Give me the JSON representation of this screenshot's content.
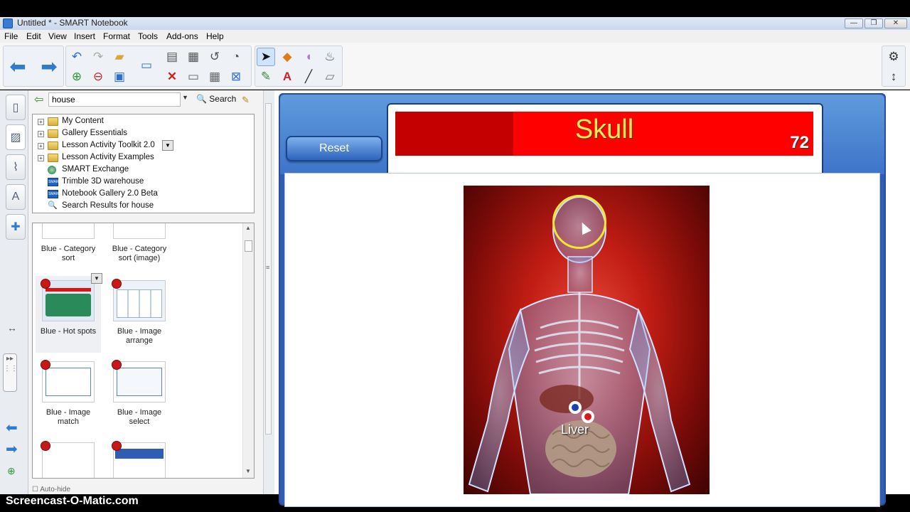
{
  "window": {
    "title": "Untitled * - SMART Notebook"
  },
  "menu": [
    "File",
    "Edit",
    "View",
    "Insert",
    "Format",
    "Tools",
    "Add-ons",
    "Help"
  ],
  "gallery": {
    "search_value": "house",
    "search_label": "Search",
    "tree": [
      {
        "label": "My Content",
        "icon": "folder-icon",
        "expandable": true
      },
      {
        "label": "Gallery Essentials",
        "icon": "folder-icon",
        "expandable": true
      },
      {
        "label": "Lesson Activity Toolkit 2.0",
        "icon": "folder-icon",
        "expandable": true
      },
      {
        "label": "Lesson Activity Examples",
        "icon": "folder-icon",
        "expandable": true
      },
      {
        "label": "SMART Exchange",
        "icon": "globe-icon",
        "expandable": false
      },
      {
        "label": "Trimble 3D warehouse",
        "icon": "smart-icon",
        "expandable": false
      },
      {
        "label": "Notebook Gallery 2.0 Beta",
        "icon": "smart-icon",
        "expandable": false
      },
      {
        "label": "Search Results for house",
        "icon": "search-icon",
        "expandable": false
      }
    ],
    "thumbnails": [
      {
        "label": "Blue - Category sort"
      },
      {
        "label": "Blue - Category sort (image)"
      },
      {
        "label": "Blue - Hot spots"
      },
      {
        "label": "Blue - Image arrange"
      },
      {
        "label": "Blue - Image match"
      },
      {
        "label": "Blue - Image select"
      }
    ],
    "autohide_label": "Auto-hide"
  },
  "activity": {
    "reset_label": "Reset",
    "target_word": "Skull",
    "score": "72",
    "organ_label": "Liver"
  },
  "colors": {
    "title_red": "#ff0000",
    "title_text": "#f7e85f",
    "board_blue": "#2f5db5",
    "hotspot_ring": "#f3e534"
  },
  "watermark": "Screencast-O-Matic.com"
}
